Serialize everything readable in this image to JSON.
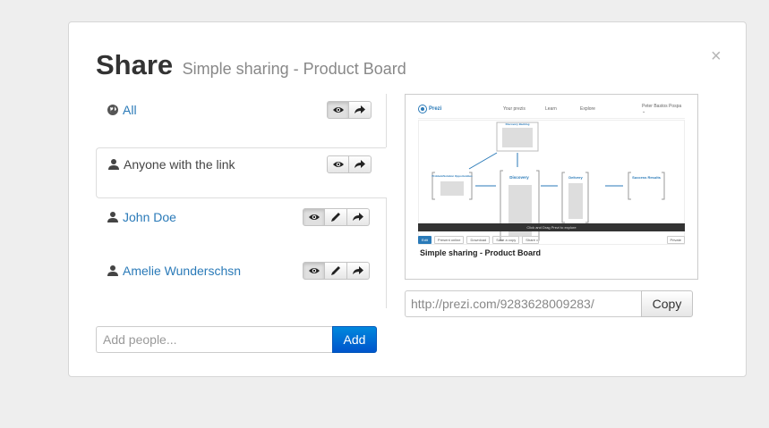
{
  "dialog": {
    "title": "Share",
    "subtitle": "Simple sharing - Product Board",
    "close_label": "×"
  },
  "share_list": [
    {
      "name": "All",
      "icon": "globe-icon",
      "permissions": [
        "view",
        "forward"
      ],
      "active": [
        "view"
      ]
    },
    {
      "name": "Anyone with the link",
      "icon": "user-icon",
      "permissions": [
        "view",
        "forward"
      ],
      "active": []
    },
    {
      "name": "John Doe",
      "icon": "user-icon",
      "permissions": [
        "view",
        "edit",
        "forward"
      ],
      "active": [
        "view"
      ]
    },
    {
      "name": "Amelie Wunderschsn",
      "icon": "user-icon",
      "permissions": [
        "view",
        "edit",
        "forward"
      ],
      "active": [
        "view"
      ]
    }
  ],
  "add_people": {
    "placeholder": "Add people...",
    "button_label": "Add"
  },
  "preview": {
    "logo_text": "Prezi",
    "nav": [
      "Your prezis",
      "Learn",
      "Explore"
    ],
    "user": "Peter Bastos Pospa ⌄",
    "bar_text": "Click and Drag Prezi to explore",
    "tools": [
      "Edit",
      "Present online",
      "Download",
      "Save a copy",
      "Share",
      "Private"
    ],
    "title": "Simple sharing - Product Board",
    "diagram_labels": [
      "Discovery Backlog",
      "Problem/Solution Opportunities",
      "Discovery",
      "Delivery",
      "Success Results"
    ]
  },
  "link": {
    "url": "http://prezi.com/9283628009283/",
    "copy_label": "Copy"
  },
  "colors": {
    "link": "#2a7ab8",
    "primary_button": "#0066cc"
  }
}
